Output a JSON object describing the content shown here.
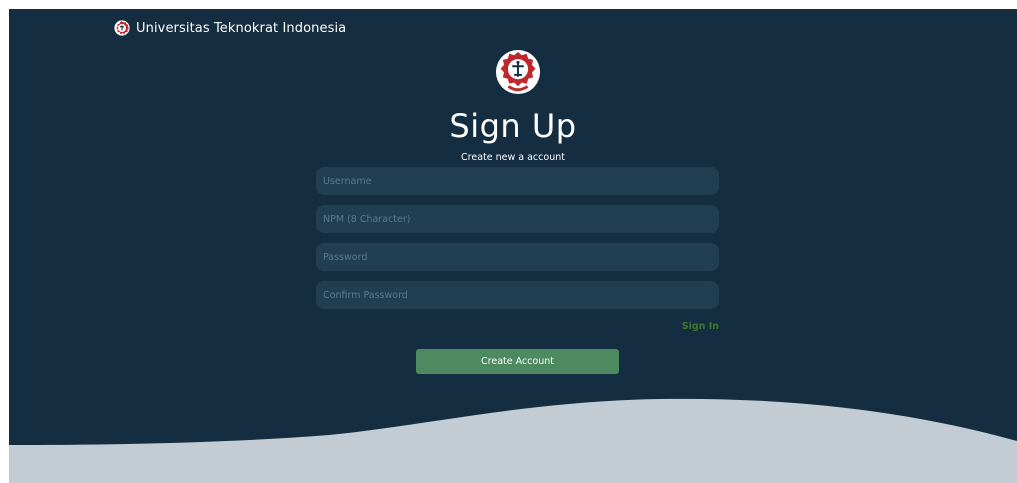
{
  "brand": {
    "name": "Universitas Teknokrat Indonesia",
    "logo_icon": "university-seal-icon"
  },
  "form": {
    "title": "Sign Up",
    "subtitle": "Create new a account",
    "fields": {
      "username_placeholder": "Username",
      "npm_placeholder": "NPM (8 Character)",
      "password_placeholder": "Password",
      "confirm_password_placeholder": "Confirm Password"
    },
    "signin_link": "Sign In",
    "submit_label": "Create Account"
  },
  "colors": {
    "background_dark": "#142d41",
    "background_light": "#c3ccd2",
    "input_fill": "#213e52",
    "button": "#4e8a5f",
    "link": "#3c7a27",
    "seal_red": "#c0272d"
  }
}
